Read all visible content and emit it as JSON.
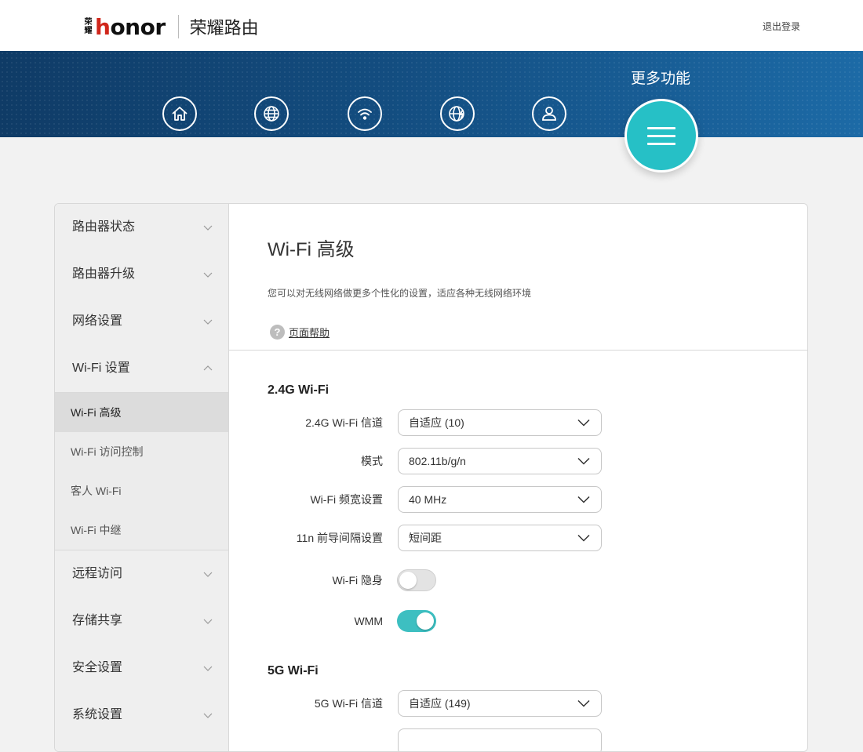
{
  "header": {
    "logo_seal_text": "荣耀",
    "logo_word": "honor",
    "product_name": "荣耀路由",
    "logout_label": "退出登录"
  },
  "banner": {
    "nav_icons": [
      "home-icon",
      "globe-icon",
      "wifi-icon",
      "globe-lightning-icon",
      "user-icon"
    ],
    "more_label": "更多功能",
    "more_icon": "menu-icon",
    "accent_color": "#26c0c6"
  },
  "sidebar": {
    "items": [
      {
        "label": "路由器状态"
      },
      {
        "label": "路由器升级"
      },
      {
        "label": "网络设置"
      },
      {
        "label": "Wi-Fi 设置"
      },
      {
        "label": "远程访问"
      },
      {
        "label": "存储共享"
      },
      {
        "label": "安全设置"
      },
      {
        "label": "系统设置"
      }
    ],
    "submenu": [
      {
        "label": "Wi-Fi 高级"
      },
      {
        "label": "Wi-Fi 访问控制"
      },
      {
        "label": "客人 Wi-Fi"
      },
      {
        "label": "Wi-Fi 中继"
      }
    ],
    "active_submenu": "Wi-Fi 高级"
  },
  "content": {
    "title": "Wi-Fi 高级",
    "description": "您可以对无线网络做更多个性化的设置，适应各种无线网络环境",
    "help_label": "页面帮助",
    "section_24g": {
      "title": "2.4G Wi-Fi",
      "channel_label": "2.4G Wi-Fi 信道",
      "channel_value": "自适应 (10)",
      "mode_label": "模式",
      "mode_value": "802.11b/g/n",
      "bandwidth_label": "Wi-Fi 频宽设置",
      "bandwidth_value": "40 MHz",
      "guard_label": "11n 前导间隔设置",
      "guard_value": "短间距",
      "hidden_label": "Wi-Fi 隐身",
      "hidden_on": false,
      "wmm_label": "WMM",
      "wmm_on": true
    },
    "section_5g": {
      "title": "5G Wi-Fi",
      "channel_label": "5G Wi-Fi 信道",
      "channel_value": "自适应 (149)"
    }
  }
}
